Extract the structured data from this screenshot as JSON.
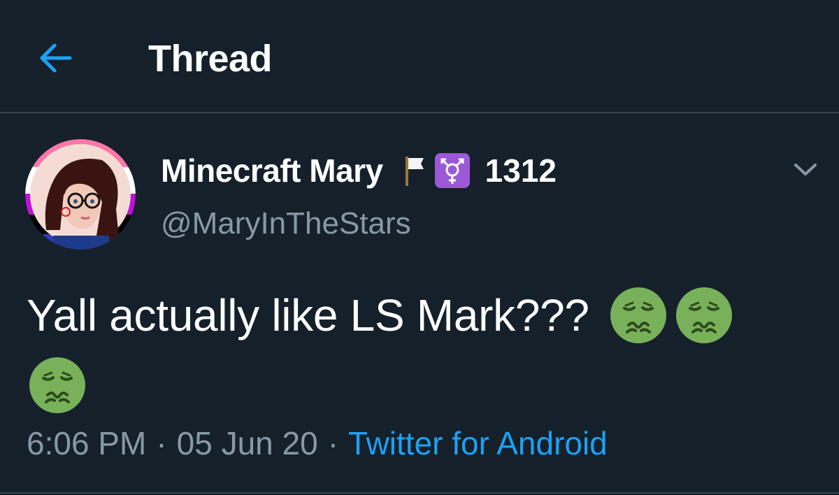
{
  "header": {
    "title": "Thread",
    "back_icon": "arrow-left-icon"
  },
  "tweet": {
    "author": {
      "display_name": "Minecraft Mary",
      "name_emojis": [
        "white-flag-icon",
        "transgender-symbol-icon"
      ],
      "name_suffix": "1312",
      "handle": "@MaryInTheStars",
      "avatar": "avatar-illustration"
    },
    "menu_icon": "chevron-down-icon",
    "text": "Yall actually like LS Mark???",
    "emojis": [
      "nauseated-face-icon",
      "nauseated-face-icon",
      "nauseated-face-icon"
    ],
    "time": "6:06 PM",
    "separator": "·",
    "date": "05 Jun 20",
    "source": "Twitter for Android"
  },
  "colors": {
    "background": "#15202b",
    "divider": "#38444d",
    "secondary_text": "#8899a6",
    "accent": "#1da1f2",
    "emoji_green": "#78b159"
  }
}
